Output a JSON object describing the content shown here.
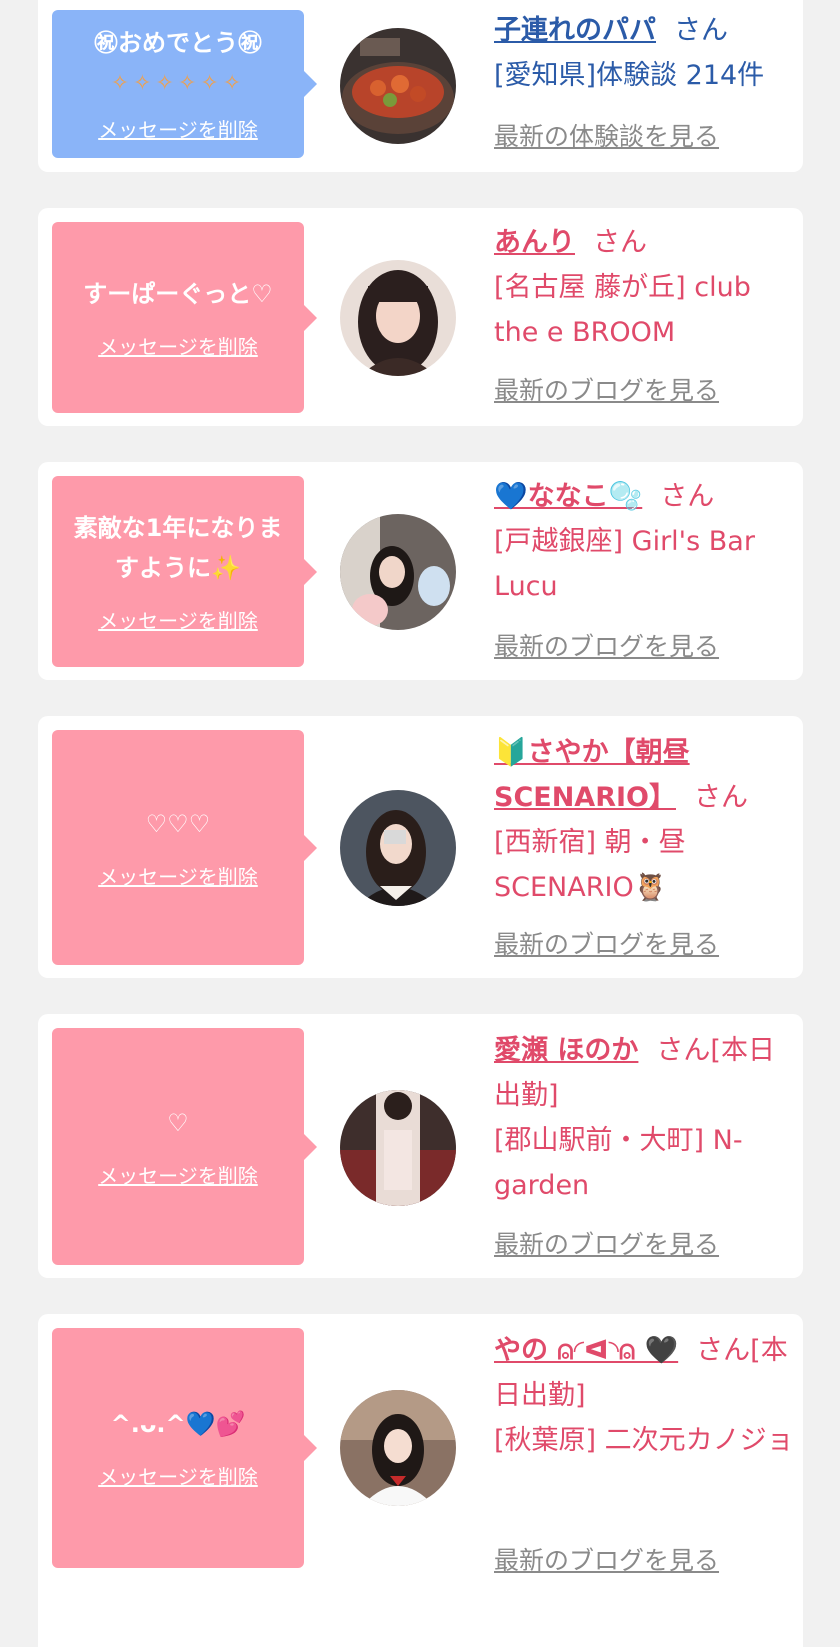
{
  "cards": [
    {
      "message": "㊗おめでとう㊗",
      "sparkles": "✧✧✧✧✧✧",
      "delete_label": "メッセージを削除",
      "name": "子連れのパパ",
      "honorific": "さん",
      "subtitle": "[愛知県]体験談 214件",
      "latest_label": "最新の体験談を見る"
    },
    {
      "message": "すーぱーぐっと♡",
      "delete_label": "メッセージを削除",
      "name": "あんり",
      "honorific": "さん",
      "subtitle": "[名古屋 藤が丘] club the e BROOM",
      "latest_label": "最新のブログを見る"
    },
    {
      "message": "素敵な1年になりますように✨",
      "delete_label": "メッセージを削除",
      "name": "💙ななこ🫧",
      "honorific": "さん",
      "subtitle": "[戸越銀座] Girl's Bar Lucu",
      "latest_label": "最新のブログを見る"
    },
    {
      "message": "♡♡♡",
      "delete_label": "メッセージを削除",
      "name": "🔰さやか【朝昼SCENARIO】",
      "honorific": "さん",
      "subtitle": "[西新宿] 朝・昼 SCENARIO🦉",
      "latest_label": "最新のブログを見る"
    },
    {
      "message": "♡",
      "delete_label": "メッセージを削除",
      "name": "愛瀬 ほのか",
      "honorific": "さん[本日出勤]",
      "subtitle": "[郡山駅前・大町] N-garden",
      "latest_label": "最新のブログを見る"
    },
    {
      "message": "^.ᴗ.^💙💕",
      "delete_label": "メッセージを削除",
      "name": "やの ⍝⁠◜⁠ᐊ⁠◝⁠⍝ 🖤",
      "honorific": "さん[本日出勤]",
      "subtitle": "[秋葉原] 二次元カノジョ",
      "latest_label": "最新のブログを見る"
    }
  ],
  "colors": {
    "pink_bubble": "#fe9aaa",
    "blue_bubble": "#8ab4f8",
    "pink_text": "#e04a6a",
    "blue_text": "#2b5ba8",
    "link_gray": "#8a8a8a"
  }
}
